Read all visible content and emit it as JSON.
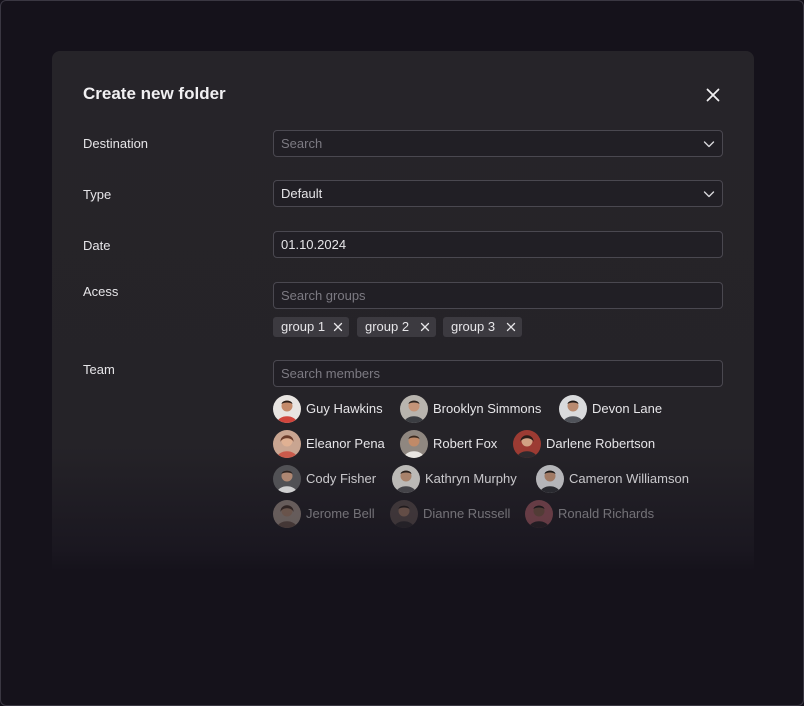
{
  "dialog": {
    "title": "Create new folder"
  },
  "destination": {
    "label": "Destination",
    "placeholder": "Search",
    "value": ""
  },
  "type": {
    "label": "Type",
    "value": "Default"
  },
  "date": {
    "label": "Date",
    "value": "01.10.2024"
  },
  "access": {
    "label": "Acess",
    "placeholder": "Search groups",
    "groups": [
      "group 1",
      "group 2",
      "group 3"
    ]
  },
  "team": {
    "label": "Team",
    "placeholder": "Search members",
    "members": [
      "Guy Hawkins",
      "Brooklyn Simmons",
      "Devon Lane",
      "Eleanor Pena",
      "Robert Fox",
      "Darlene Robertson",
      "Cody Fisher",
      "Kathryn Murphy",
      "Cameron Williamson",
      "Jerome Bell",
      "Dianne Russell",
      "Ronald Richards"
    ]
  },
  "icons": {
    "close": "close-icon",
    "dropdown": "chevron-down-icon",
    "remove_chip": "remove-icon"
  },
  "colors": {
    "background": "#15121b",
    "dialog": "#262429",
    "field_border": "#4a4850",
    "chip": "#3c3a40",
    "text": "#e6e5e8",
    "placeholder": "#7c7a82"
  }
}
